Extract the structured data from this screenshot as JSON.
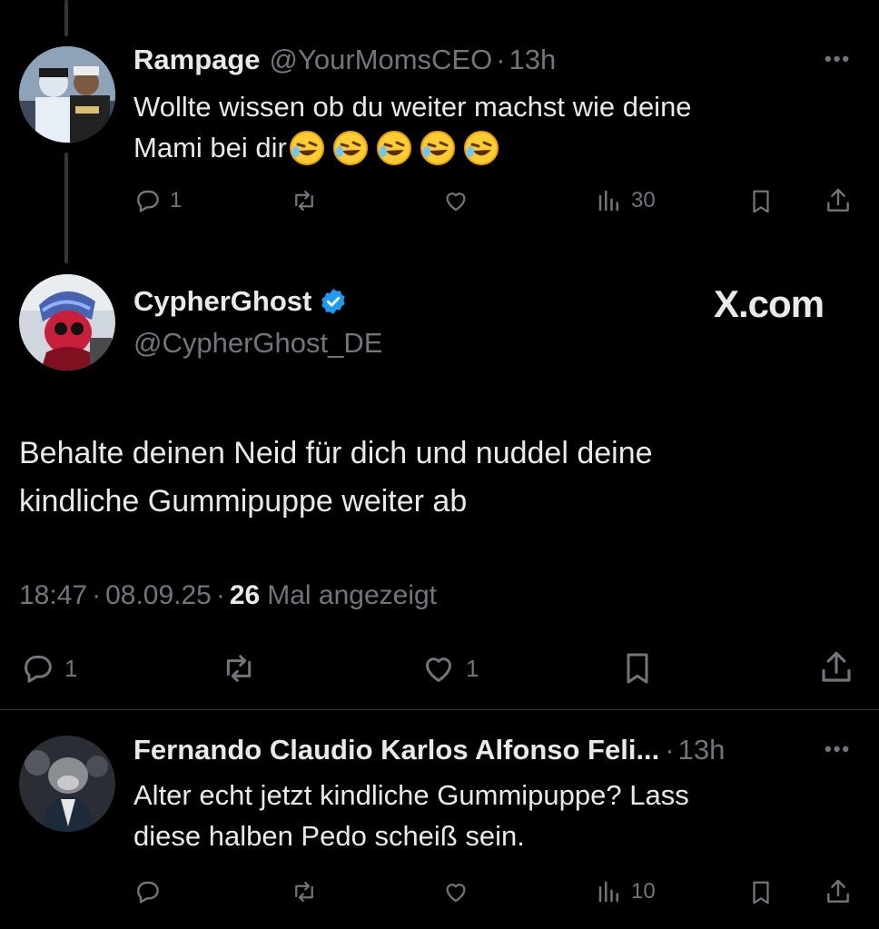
{
  "colors": {
    "background": "#000000",
    "text": "#e7e9ea",
    "muted": "#71767b",
    "verified": "#1d9bf0",
    "divider": "#2f3336"
  },
  "reply1": {
    "display_name": "Rampage",
    "handle": "@YourMomsCEO",
    "sep": "·",
    "time": "13h",
    "text_line1": "Wollte wissen ob du weiter machst wie deine",
    "text_line2": "Mami bei dir",
    "emoji": "rolling-on-floor-laughing",
    "emoji_count": 5,
    "replies": "1",
    "views": "30"
  },
  "main_tweet": {
    "display_name": "CypherGhost",
    "handle": "@CypherGhost_DE",
    "verified": true,
    "watermark": "X.com",
    "text_line1": "Behalte deinen Neid für dich und nuddel deine",
    "text_line2": "kindliche Gummipuppe weiter ab",
    "time": "18:47",
    "date": "08.09.25",
    "sep": "·",
    "views_count": "26",
    "views_label": "Mal angezeigt",
    "replies": "1",
    "likes": "1"
  },
  "reply2": {
    "display_name": "Fernando Claudio Karlos Alfonso Feli...",
    "sep": "·",
    "time": "13h",
    "text_line1": "Alter echt jetzt kindliche Gummipuppe? Lass",
    "text_line2": "diese halben Pedo scheiß sein.",
    "views": "10"
  }
}
